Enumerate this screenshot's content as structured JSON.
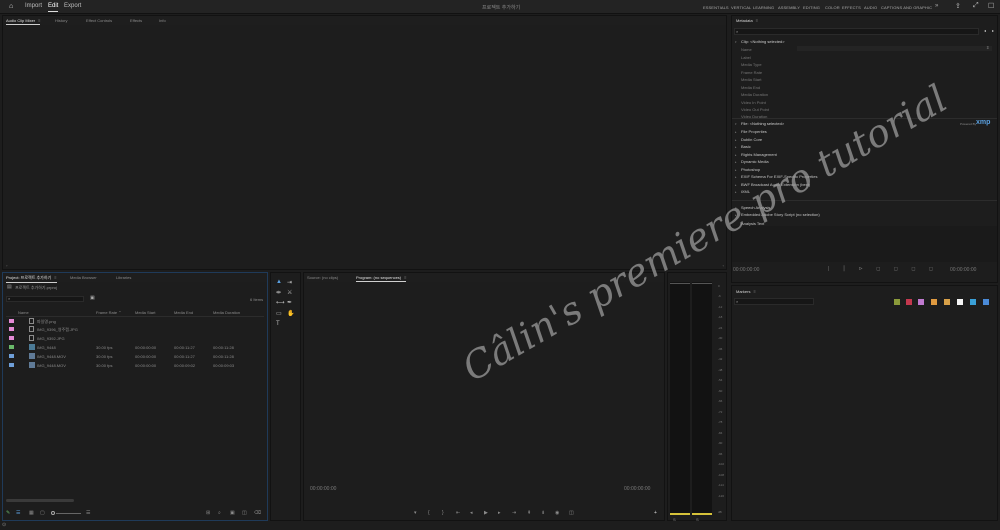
{
  "menubar": {
    "items": [
      {
        "label": "Import",
        "active": false
      },
      {
        "label": "Edit",
        "active": true
      },
      {
        "label": "Export",
        "active": false
      }
    ],
    "project_title": "프로젝트 추가하기",
    "workspaces": [
      {
        "label": "ESSENTIALS",
        "active": false
      },
      {
        "label": "VERTICAL",
        "active": false
      },
      {
        "label": "LEARNING",
        "active": false
      },
      {
        "label": "ASSEMBLY",
        "active": false
      },
      {
        "label": "EDITING",
        "active": false
      },
      {
        "label": "COLOR",
        "active": false
      },
      {
        "label": "EFFECTS",
        "active": false
      },
      {
        "label": "AUDIO",
        "active": false
      },
      {
        "label": "CAPTIONS AND GRAPHIC",
        "active": false
      }
    ]
  },
  "top_panel": {
    "tabs": [
      {
        "label": "Audio Clip Mixer",
        "active": true
      },
      {
        "label": "History",
        "active": false
      },
      {
        "label": "Effect Controls",
        "active": false
      },
      {
        "label": "Effects",
        "active": false
      },
      {
        "label": "Info",
        "active": false
      }
    ]
  },
  "metadata": {
    "title": "Metadata",
    "clip_label": "Clip:",
    "clip_value": "<Nothing selected>",
    "clip_fields": [
      "Name",
      "Label",
      "Media Type",
      "Frame Rate",
      "Media Start",
      "Media End",
      "Media Duration",
      "Video In Point",
      "Video Out Point",
      "Video Duration"
    ],
    "file_label": "File:",
    "file_value": "<Nothing selected>",
    "powered_by": "Powered By",
    "xmp": "xmp",
    "schemas": [
      "File Properties",
      "Dublin Core",
      "Basic",
      "Rights Management",
      "Dynamic Media",
      "Photoshop",
      "EXIF Schema For EXIF-Specific Properties",
      "BWF Broadcast Audio Extension (bext)",
      "iXML"
    ],
    "speech_title": "Speech Analysis",
    "speech_script": "Embedded Adobe Story Script (no selection)",
    "analysis_text": "Analysis Text",
    "tc_left": "00:00:00:00",
    "tc_right": "00:00:00:00"
  },
  "project": {
    "tabs": [
      {
        "label": "Project: 프로젝트 추가하기",
        "active": true
      },
      {
        "label": "Media Browser",
        "active": false
      },
      {
        "label": "Libraries",
        "active": false
      }
    ],
    "file_name": "프로젝트 추가하기.prproj",
    "item_count": "6 Items",
    "columns": [
      "Name",
      "Frame Rate",
      "Media Start",
      "Media End",
      "Media Duration"
    ],
    "rows": [
      {
        "color": "#e58ad6",
        "type": "image",
        "name": "파일명.png",
        "fps": "",
        "start": "",
        "end": "",
        "dur": ""
      },
      {
        "color": "#e58ad6",
        "type": "image",
        "name": "IMG_9396_영주캡.JPG",
        "fps": "",
        "start": "",
        "end": "",
        "dur": ""
      },
      {
        "color": "#e58ad6",
        "type": "image",
        "name": "IMG_9392.JPG",
        "fps": "",
        "start": "",
        "end": "",
        "dur": ""
      },
      {
        "color": "#6ab96a",
        "type": "sequence",
        "name": "IMG_9448",
        "fps": "30.00 fps",
        "start": "00:00:00:00",
        "end": "00:00:11:27",
        "dur": "00:00:11:28"
      },
      {
        "color": "#6f9fd8",
        "type": "video",
        "name": "IMG_9448.MOV",
        "fps": "30.00 fps",
        "start": "00:00:00:00",
        "end": "00:00:11:27",
        "dur": "00:00:11:28"
      },
      {
        "color": "#6f9fd8",
        "type": "video",
        "name": "IMG_9448.MOV",
        "fps": "30.00 fps",
        "start": "00:00:00:00",
        "end": "00:00:09:02",
        "dur": "00:00:09:03"
      }
    ]
  },
  "monitor": {
    "tabs": [
      {
        "label": "Source: (no clips)",
        "active": false
      },
      {
        "label": "Program: (no sequences)",
        "active": true
      }
    ],
    "tc_left": "00:00:00:00",
    "tc_right": "00:00:00:00"
  },
  "markers": {
    "title": "Markers",
    "swatches": [
      "#8a9a3a",
      "#c4384e",
      "#c07ad0",
      "#e09a40",
      "#d8a048",
      "#f4f4f4",
      "#3aa0d8",
      "#4a8ad8"
    ]
  },
  "meter": {
    "labels": [
      "0",
      "-6",
      "-12",
      "-18",
      "-24",
      "-30",
      "-36",
      "-42",
      "-48",
      "-54",
      "-60",
      "-66",
      "-72",
      "-78",
      "-84",
      "-90",
      "-96",
      "-102",
      "-108",
      "-114",
      "-120",
      "dB"
    ]
  },
  "watermark": "Câlin's premiere pro tutorial"
}
